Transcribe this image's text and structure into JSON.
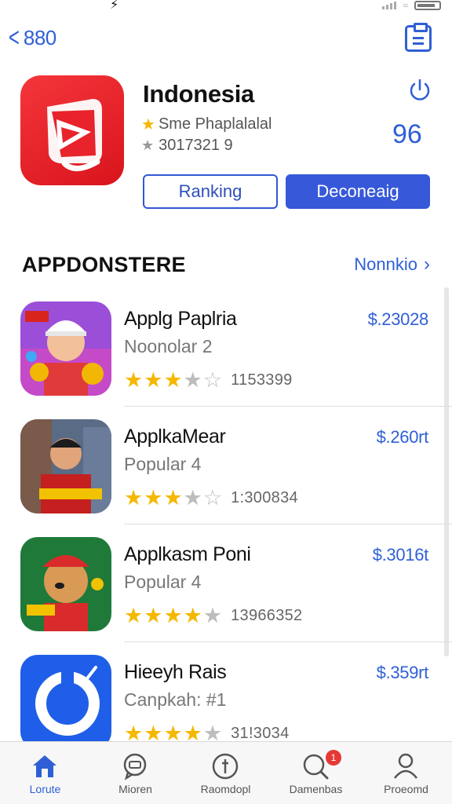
{
  "nav": {
    "back_label": "880"
  },
  "app": {
    "title": "Indonesia",
    "rating_text": "Sme Phaplalalal",
    "count_text": "3017321 9",
    "side_number": "96",
    "primary_button": "Ranking",
    "secondary_button": "Deconeaig"
  },
  "section": {
    "title": "APPDONSTERE",
    "see_all": "Nonnkio"
  },
  "rows": [
    {
      "name": "Applg Paplria",
      "sub": "Noonolar 2",
      "price": "$.23028",
      "count": "1153399",
      "rating": 3.5
    },
    {
      "name": "ApplkaMear",
      "sub": "Popular 4",
      "price": "$.260rt",
      "count": "1:300834",
      "rating": 3.5
    },
    {
      "name": "Applkasm Poni",
      "sub": "Popular 4",
      "price": "$.3016t",
      "count": "13966352",
      "rating": 4
    },
    {
      "name": "Hieeyh Rais",
      "sub": "Canpkah: #1",
      "price": "$.359rt",
      "count": "31!3034",
      "rating": 4
    }
  ],
  "tabs": [
    {
      "label": "Lorute",
      "icon": "home-icon",
      "active": true
    },
    {
      "label": "Mioren",
      "icon": "chat-icon"
    },
    {
      "label": "Raomdopl",
      "icon": "compass-icon"
    },
    {
      "label": "Damenbas",
      "icon": "search-icon",
      "badge": "1"
    },
    {
      "label": "Proeomd",
      "icon": "person-icon"
    }
  ],
  "colors": {
    "accent": "#2f5fd6",
    "star": "#f5b800",
    "app_icon": "#e8232b",
    "badge": "#e53935"
  }
}
